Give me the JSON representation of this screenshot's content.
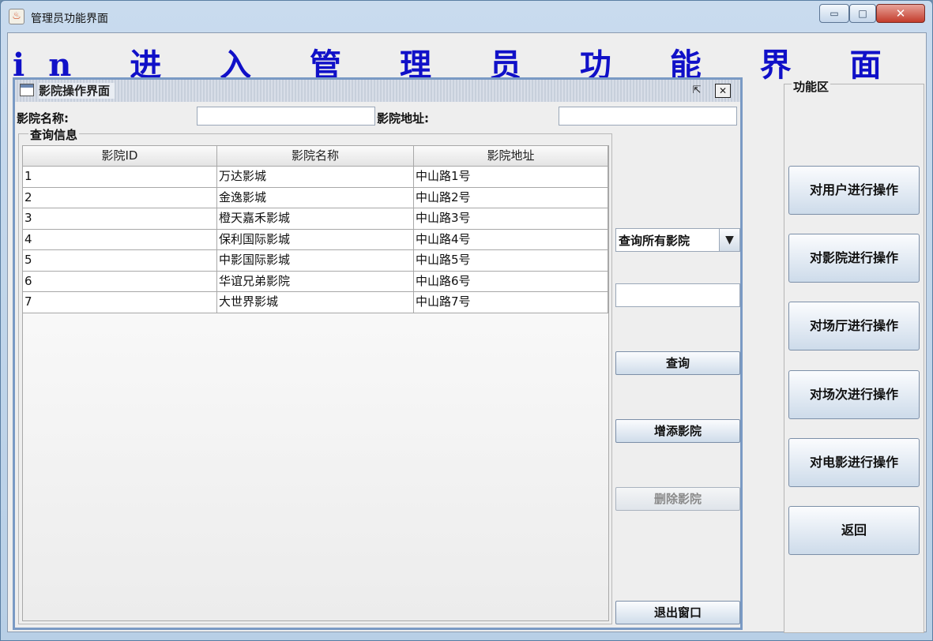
{
  "window": {
    "title": "管理员功能界面",
    "controls": {
      "minimize": "▭",
      "maximize": "□",
      "close": "✕"
    }
  },
  "banner": "in 进 入 管 理 员 功 能 界 面",
  "internal_frame": {
    "title": "影院操作界面",
    "restore_icon": "⇱",
    "close_icon": "✕"
  },
  "search_form": {
    "name_label": "影院名称:",
    "name_value": "",
    "address_label": "影院地址:",
    "address_value": ""
  },
  "results": {
    "group_title": "查询信息",
    "columns": [
      "影院ID",
      "影院名称",
      "影院地址"
    ],
    "rows": [
      [
        "1",
        "万达影城",
        "中山路1号"
      ],
      [
        "2",
        "金逸影城",
        "中山路2号"
      ],
      [
        "3",
        "橙天嘉禾影城",
        "中山路3号"
      ],
      [
        "4",
        "保利国际影城",
        "中山路4号"
      ],
      [
        "5",
        "中影国际影城",
        "中山路5号"
      ],
      [
        "6",
        "华谊兄弟影院",
        "中山路6号"
      ],
      [
        "7",
        "大世界影城",
        "中山路7号"
      ]
    ]
  },
  "controls": {
    "query_mode": "查询所有影院",
    "query_input": "",
    "query_button": "查询",
    "add_button": "增添影院",
    "delete_button": "删除影院",
    "exit_button": "退出窗口"
  },
  "function_area": {
    "title": "功能区",
    "buttons": [
      "对用户进行操作",
      "对影院进行操作",
      "对场厅进行操作",
      "对场次进行操作",
      "对电影进行操作",
      "返回"
    ]
  }
}
